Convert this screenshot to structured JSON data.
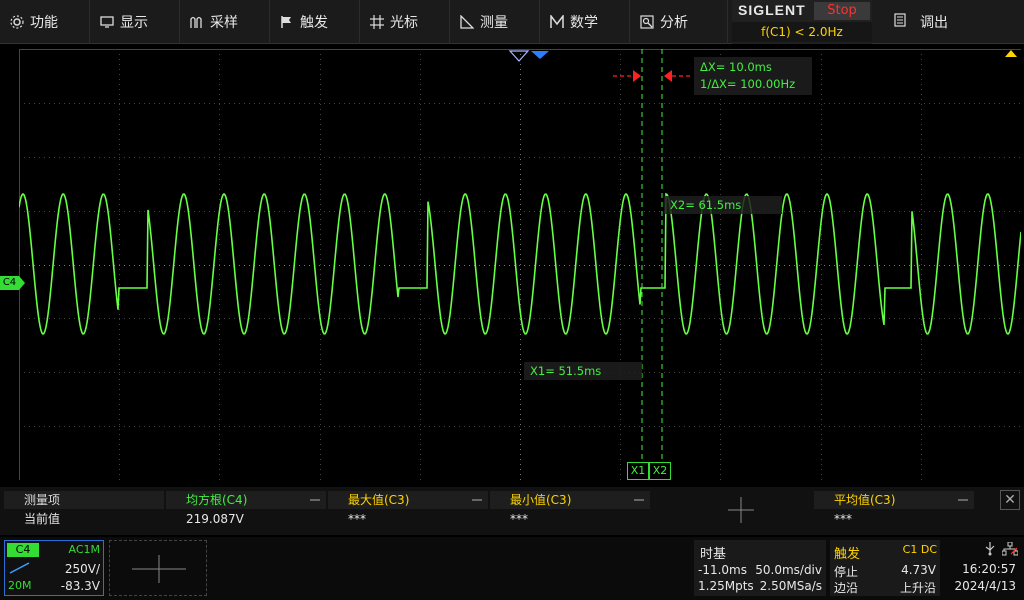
{
  "menu": [
    {
      "label": "功能",
      "icon": "gear-icon"
    },
    {
      "label": "显示",
      "icon": "monitor-icon"
    },
    {
      "label": "采样",
      "icon": "sample-icon"
    },
    {
      "label": "触发",
      "icon": "flag-icon"
    },
    {
      "label": "光标",
      "icon": "crosshair-icon"
    },
    {
      "label": "测量",
      "icon": "ruler-icon"
    },
    {
      "label": "数学",
      "icon": "math-icon"
    },
    {
      "label": "分析",
      "icon": "analysis-icon"
    }
  ],
  "brand": {
    "logo": "SIGLENT",
    "status": "Stop",
    "trigger_info": "f(C1) < 2.0Hz"
  },
  "tune_label": "调出",
  "channel_marker": "C4",
  "cursors": {
    "delta_x": "ΔX= 10.0ms",
    "inv_delta_x": "1/ΔX= 100.00Hz",
    "x1_readout": "X1= 51.5ms",
    "x2_readout": "X2= 61.5ms",
    "x1_tag": "X1",
    "x2_tag": "X2"
  },
  "measurements": {
    "row_header": "测量项",
    "row_value": "当前值",
    "columns": [
      {
        "name": "均方根(C4)",
        "value": "219.087V",
        "color": "#44ee44"
      },
      {
        "name": "最大值(C3)",
        "value": "***",
        "color": "#ffd400"
      },
      {
        "name": "最小值(C3)",
        "value": "***",
        "color": "#ffd400"
      },
      {
        "name": "平均值(C3)",
        "value": "***",
        "color": "#ffd400"
      }
    ]
  },
  "channel": {
    "tag": "C4",
    "coupling": "AC1M",
    "scale": "250V/",
    "bandwidth": "20M",
    "offset": "-83.3V"
  },
  "timebase": {
    "title": "时基",
    "delay": "-11.0ms",
    "scale": "50.0ms/div",
    "depth": "1.25Mpts",
    "sample_rate": "2.50MSa/s"
  },
  "trigger": {
    "title": "触发",
    "source": "C1 DC",
    "state": "停止",
    "level": "4.73V",
    "type": "边沿",
    "slope": "上升沿"
  },
  "clock": {
    "time": "16:20:57",
    "date": "2024/4/13"
  },
  "colors": {
    "ch4": "#33dd33",
    "trigger": "#ffd400",
    "stop": "#ff3030",
    "cursor_marker": "#ff2020"
  }
}
